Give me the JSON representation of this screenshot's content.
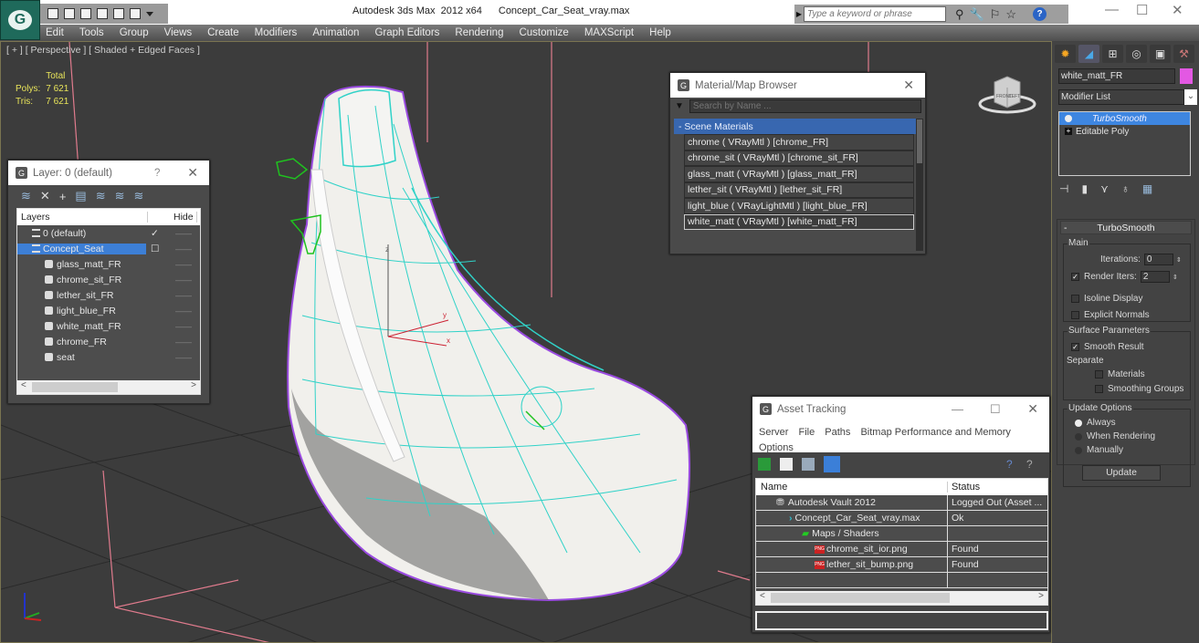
{
  "app": {
    "title": "Autodesk 3ds Max  2012 x64",
    "file": "Concept_Car_Seat_vray.max",
    "search_placeholder": "Type a keyword or phrase",
    "window_controls": {
      "minimize": "—",
      "maximize": "☐",
      "close": "✕"
    }
  },
  "menu": [
    "Edit",
    "Tools",
    "Group",
    "Views",
    "Create",
    "Modifiers",
    "Animation",
    "Graph Editors",
    "Rendering",
    "Customize",
    "MAXScript",
    "Help"
  ],
  "viewport": {
    "label": "[ + ] [ Perspective ] [ Shaded + Edged Faces ]",
    "stats": {
      "header": "Total",
      "polys_label": "Polys:",
      "polys": "7 621",
      "tris_label": "Tris:",
      "tris": "7 621"
    },
    "viewcube": {
      "face_left": "FRONT",
      "face_right": "LEFT"
    },
    "gizmo_labels": {
      "x": "x",
      "y": "y",
      "z": "z"
    }
  },
  "layer_panel": {
    "title": "Layer: 0 (default)",
    "help": "?",
    "close": "✕",
    "tools": [
      "create-layer",
      "delete",
      "add",
      "select-objects",
      "select-layer",
      "highlight",
      "hide-freeze"
    ],
    "columns": {
      "name": "Layers",
      "hide": "Hide"
    },
    "rows": [
      {
        "name": "0 (default)",
        "type": "layer",
        "check": "✓",
        "hide": "——"
      },
      {
        "name": "Concept_Seat",
        "type": "layer",
        "selected": true,
        "check": "☐",
        "hide": "——"
      },
      {
        "name": "glass_matt_FR",
        "type": "object",
        "hide": "——"
      },
      {
        "name": "chrome_sit_FR",
        "type": "object",
        "hide": "——"
      },
      {
        "name": "lether_sit_FR",
        "type": "object",
        "hide": "——"
      },
      {
        "name": "light_blue_FR",
        "type": "object",
        "hide": "——"
      },
      {
        "name": "white_matt_FR",
        "type": "object",
        "hide": "——"
      },
      {
        "name": "chrome_FR",
        "type": "object",
        "hide": "——"
      },
      {
        "name": "seat",
        "type": "object",
        "hide": "——"
      }
    ],
    "scroll_left": "<",
    "scroll_right": ">"
  },
  "material_browser": {
    "title": "Material/Map Browser",
    "close": "✕",
    "search_placeholder": "Search by Name ...",
    "group": "- Scene Materials",
    "items": [
      "chrome  ( VRayMtl ) [chrome_FR]",
      "chrome_sit  ( VRayMtl ) [chrome_sit_FR]",
      "glass_matt  ( VRayMtl ) [glass_matt_FR]",
      "lether_sit  ( VRayMtl ) [lether_sit_FR]",
      "light_blue  ( VRayLightMtl ) [light_blue_FR]",
      "white_matt  ( VRayMtl ) [white_matt_FR]"
    ],
    "selected_index": 5
  },
  "command_panel": {
    "tabs": [
      "create",
      "modify",
      "hierarchy",
      "motion",
      "display",
      "utilities"
    ],
    "object_name": "white_matt_FR",
    "object_color": "#e358e3",
    "modifier_list": "Modifier List",
    "stack": [
      "TurboSmooth",
      "Editable Poly"
    ],
    "turbosmooth": {
      "title": "TurboSmooth",
      "main_label": "Main",
      "iterations_label": "Iterations:",
      "iterations": "0",
      "render_iters_label": "Render Iters:",
      "render_iters": "2",
      "render_iters_checked": true,
      "isoline_label": "Isoline Display",
      "explicit_label": "Explicit Normals",
      "surface_label": "Surface Parameters",
      "smooth_result_label": "Smooth Result",
      "smooth_result_checked": true,
      "separate_label": "Separate",
      "materials_label": "Materials",
      "smoothing_groups_label": "Smoothing Groups",
      "update_options_label": "Update Options",
      "always_label": "Always",
      "when_rendering_label": "When Rendering",
      "manually_label": "Manually",
      "update_button": "Update",
      "update_mode": "Always"
    }
  },
  "asset_tracking": {
    "title": "Asset Tracking",
    "menu": [
      "Server",
      "File",
      "Paths",
      "Bitmap Performance and Memory",
      "Options"
    ],
    "columns": {
      "name": "Name",
      "status": "Status"
    },
    "rows": [
      {
        "name": "Autodesk Vault 2012",
        "status": "Logged Out (Asset ..."
      },
      {
        "name": "Concept_Car_Seat_vray.max",
        "status": "Ok"
      },
      {
        "name": "Maps / Shaders",
        "status": ""
      },
      {
        "name": "chrome_sit_ior.png",
        "status": "Found"
      },
      {
        "name": "lether_sit_bump.png",
        "status": "Found"
      }
    ]
  }
}
